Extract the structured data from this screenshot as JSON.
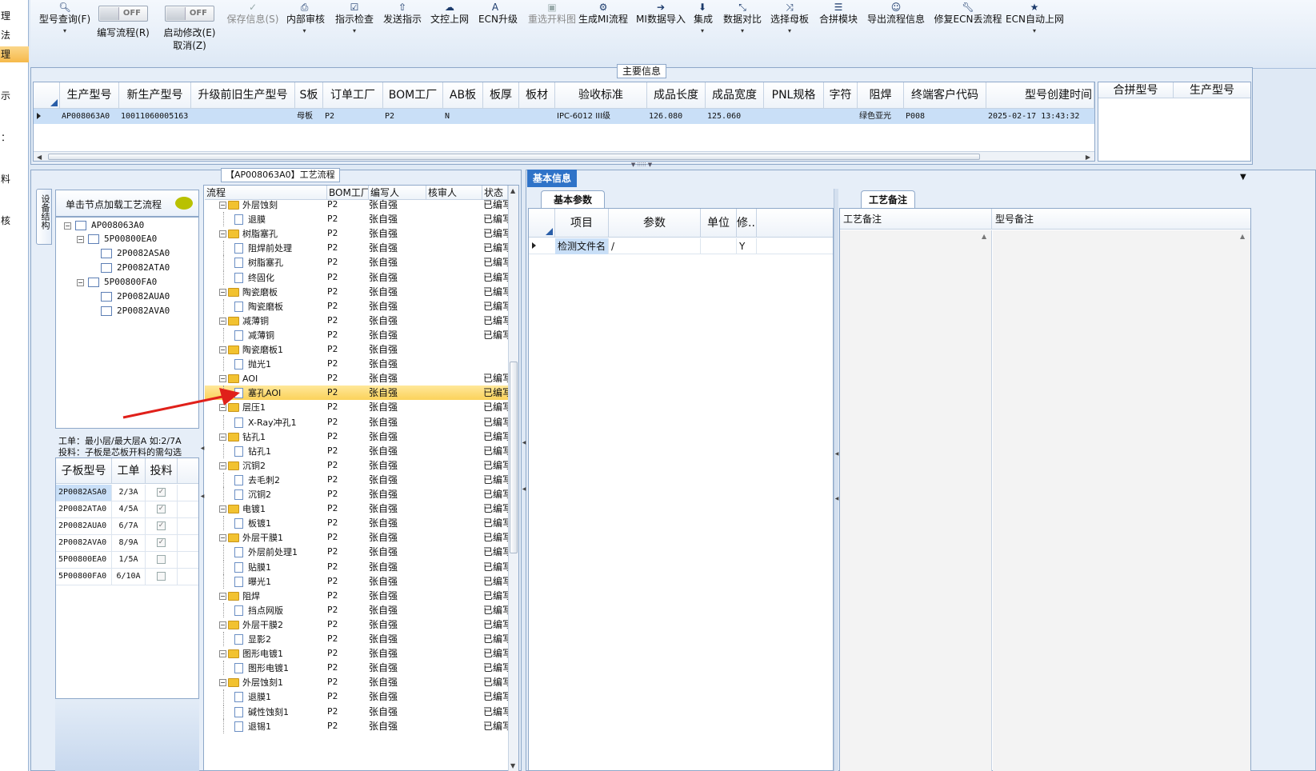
{
  "leftnav": {
    "items": [
      "理",
      "法",
      "理",
      "示",
      "：",
      "料",
      "核"
    ]
  },
  "toolbar": {
    "items": [
      {
        "icon": "🔍︎",
        "label": "型号查询(F)",
        "disabled": false
      },
      {
        "icon": "✓",
        "label": "保存信息(S)",
        "disabled": true
      },
      {
        "icon": "⎙",
        "label": "内部审核",
        "disabled": false
      },
      {
        "icon": "☑",
        "label": "指示检查",
        "disabled": false
      },
      {
        "icon": "⇧",
        "label": "发送指示",
        "disabled": false
      },
      {
        "icon": "☁",
        "label": "文控上网",
        "disabled": false
      },
      {
        "icon": "A",
        "label": "ECN升级",
        "disabled": false
      },
      {
        "icon": "▣",
        "label": "重选开料图",
        "disabled": true
      },
      {
        "icon": "⚙",
        "label": "生成MI流程",
        "disabled": false
      },
      {
        "icon": "➔",
        "label": "MI数据导入",
        "disabled": false
      },
      {
        "icon": "⬇",
        "label": "集成",
        "disabled": false
      },
      {
        "icon": "⤡",
        "label": "数据对比",
        "disabled": false
      },
      {
        "icon": "⤨",
        "label": "选择母板",
        "disabled": false
      },
      {
        "icon": "☰",
        "label": "合拼模块",
        "disabled": false
      },
      {
        "icon": "☺",
        "label": "导出流程信息",
        "disabled": false
      },
      {
        "icon": "🔧︎",
        "label": "修复ECN丢流程",
        "disabled": false
      },
      {
        "icon": "★",
        "label": "ECN自动上网",
        "disabled": false
      }
    ],
    "toggles": [
      {
        "state": "OFF",
        "label": "编写流程(R)"
      },
      {
        "state": "OFF",
        "label": "启动修改(E)",
        "label2": "取消(Z)"
      }
    ]
  },
  "main_info": {
    "title": "主要信息",
    "columns": [
      "生产型号",
      "新生产型号",
      "升级前旧生产型号",
      "S板",
      "订单工厂",
      "BOM工厂",
      "AB板",
      "板厚",
      "板材",
      "验收标准",
      "成品长度",
      "成品宽度",
      "PNL规格",
      "字符",
      "阻焊",
      "终端客户代码",
      "型号创建时间"
    ],
    "row": [
      "AP008063A0",
      "10011060005163",
      "",
      "母板",
      "P2",
      "P2",
      "N",
      "",
      "",
      "IPC-6012 III级",
      "126.080",
      "125.060",
      "",
      "",
      "绿色亚光",
      "P008",
      "2025-02-17 13:43:32"
    ],
    "side_columns": [
      "合拼型号",
      "生产型号"
    ]
  },
  "flow_panel": {
    "title": "【AP008063A0】工艺流程",
    "side_tab": "设备结构",
    "node_hint": "单击节点加载工艺流程",
    "tree": [
      {
        "label": "AP008063A0",
        "level": 0
      },
      {
        "label": "5P00800EA0",
        "level": 1
      },
      {
        "label": "2P0082ASA0",
        "level": 2
      },
      {
        "label": "2P0082ATA0",
        "level": 2
      },
      {
        "label": "5P00800FA0",
        "level": 1
      },
      {
        "label": "2P0082AUA0",
        "level": 2
      },
      {
        "label": "2P0082AVA0",
        "level": 2
      }
    ],
    "note_line1": "工单：最小层/最大层A 如:2/7A",
    "note_line2": "投料：子板是芯板开料的需勾选",
    "sub_columns": [
      "子板型号",
      "工单",
      "投料"
    ],
    "sub_rows": [
      {
        "model": "2P0082ASA0",
        "order": "2/3A",
        "feed": true
      },
      {
        "model": "2P0082ATA0",
        "order": "4/5A",
        "feed": true
      },
      {
        "model": "2P0082AUA0",
        "order": "6/7A",
        "feed": true
      },
      {
        "model": "2P0082AVA0",
        "order": "8/9A",
        "feed": true
      },
      {
        "model": "5P00800EA0",
        "order": "1/5A",
        "feed": false
      },
      {
        "model": "5P00800FA0",
        "order": "6/10A",
        "feed": false
      }
    ]
  },
  "process": {
    "columns": [
      "流程",
      "BOM工厂",
      "编写人",
      "核审人",
      "状态"
    ],
    "rows": [
      {
        "name": "外层蚀刻",
        "folder": true,
        "bom": "P2",
        "writer": "张自强",
        "status": "已编写"
      },
      {
        "name": "退膜",
        "folder": false,
        "bom": "P2",
        "writer": "张自强",
        "status": "已编写"
      },
      {
        "name": "树脂塞孔",
        "folder": true,
        "bom": "P2",
        "writer": "张自强",
        "status": "已编写"
      },
      {
        "name": "阻焊前处理",
        "folder": false,
        "bom": "P2",
        "writer": "张自强",
        "status": "已编写"
      },
      {
        "name": "树脂塞孔",
        "folder": false,
        "bom": "P2",
        "writer": "张自强",
        "status": "已编写"
      },
      {
        "name": "终固化",
        "folder": false,
        "bom": "P2",
        "writer": "张自强",
        "status": "已编写"
      },
      {
        "name": "陶瓷磨板",
        "folder": true,
        "bom": "P2",
        "writer": "张自强",
        "status": "已编写"
      },
      {
        "name": "陶瓷磨板",
        "folder": false,
        "bom": "P2",
        "writer": "张自强",
        "status": "已编写"
      },
      {
        "name": "减薄铜",
        "folder": true,
        "bom": "P2",
        "writer": "张自强",
        "status": "已编写"
      },
      {
        "name": "减薄铜",
        "folder": false,
        "bom": "P2",
        "writer": "张自强",
        "status": "已编写"
      },
      {
        "name": "陶瓷磨板1",
        "folder": true,
        "bom": "P2",
        "writer": "张自强",
        "status": ""
      },
      {
        "name": "抛光1",
        "folder": false,
        "bom": "P2",
        "writer": "张自强",
        "status": ""
      },
      {
        "name": "AOI",
        "folder": true,
        "bom": "P2",
        "writer": "张自强",
        "status": "已编写"
      },
      {
        "name": "塞孔AOI",
        "folder": false,
        "bom": "P2",
        "writer": "张自强",
        "status": "已编写",
        "selected": true
      },
      {
        "name": "层压1",
        "folder": true,
        "bom": "P2",
        "writer": "张自强",
        "status": "已编写"
      },
      {
        "name": "X-Ray冲孔1",
        "folder": false,
        "bom": "P2",
        "writer": "张自强",
        "status": "已编写"
      },
      {
        "name": "钻孔1",
        "folder": true,
        "bom": "P2",
        "writer": "张自强",
        "status": "已编写"
      },
      {
        "name": "钻孔1",
        "folder": false,
        "bom": "P2",
        "writer": "张自强",
        "status": "已编写"
      },
      {
        "name": "沉铜2",
        "folder": true,
        "bom": "P2",
        "writer": "张自强",
        "status": "已编写"
      },
      {
        "name": "去毛刺2",
        "folder": false,
        "bom": "P2",
        "writer": "张自强",
        "status": "已编写"
      },
      {
        "name": "沉铜2",
        "folder": false,
        "bom": "P2",
        "writer": "张自强",
        "status": "已编写"
      },
      {
        "name": "电镀1",
        "folder": true,
        "bom": "P2",
        "writer": "张自强",
        "status": "已编写"
      },
      {
        "name": "板镀1",
        "folder": false,
        "bom": "P2",
        "writer": "张自强",
        "status": "已编写"
      },
      {
        "name": "外层干膜1",
        "folder": true,
        "bom": "P2",
        "writer": "张自强",
        "status": "已编写"
      },
      {
        "name": "外层前处理1",
        "folder": false,
        "bom": "P2",
        "writer": "张自强",
        "status": "已编写"
      },
      {
        "name": "贴膜1",
        "folder": false,
        "bom": "P2",
        "writer": "张自强",
        "status": "已编写"
      },
      {
        "name": "曝光1",
        "folder": false,
        "bom": "P2",
        "writer": "张自强",
        "status": "已编写"
      },
      {
        "name": "阻焊",
        "folder": true,
        "bom": "P2",
        "writer": "张自强",
        "status": "已编写"
      },
      {
        "name": "挡点网版",
        "folder": false,
        "bom": "P2",
        "writer": "张自强",
        "status": "已编写"
      },
      {
        "name": "外层干膜2",
        "folder": true,
        "bom": "P2",
        "writer": "张自强",
        "status": "已编写"
      },
      {
        "name": "显影2",
        "folder": false,
        "bom": "P2",
        "writer": "张自强",
        "status": "已编写"
      },
      {
        "name": "图形电镀1",
        "folder": true,
        "bom": "P2",
        "writer": "张自强",
        "status": "已编写"
      },
      {
        "name": "图形电镀1",
        "folder": false,
        "bom": "P2",
        "writer": "张自强",
        "status": "已编写"
      },
      {
        "name": "外层蚀刻1",
        "folder": true,
        "bom": "P2",
        "writer": "张自强",
        "status": "已编写"
      },
      {
        "name": "退膜1",
        "folder": false,
        "bom": "P2",
        "writer": "张自强",
        "status": "已编写"
      },
      {
        "name": "碱性蚀刻1",
        "folder": false,
        "bom": "P2",
        "writer": "张自强",
        "status": "已编写"
      },
      {
        "name": "退锡1",
        "folder": false,
        "bom": "P2",
        "writer": "张自强",
        "status": "已编写"
      }
    ]
  },
  "basic_info": {
    "tab": "基本信息",
    "sub_tab": "基本参数",
    "columns": [
      "项目",
      "参数",
      "单位",
      "修..."
    ],
    "row": [
      "检测文件名",
      "/",
      "",
      "Y"
    ]
  },
  "remarks": {
    "tab": "工艺备注",
    "col1": "工艺备注",
    "col2": "型号备注"
  },
  "colors": {
    "selection": "#fbd25a",
    "header_blue": "#2f73c8",
    "row_highlight": "#c9dff7",
    "arrow": "#e0201a"
  }
}
